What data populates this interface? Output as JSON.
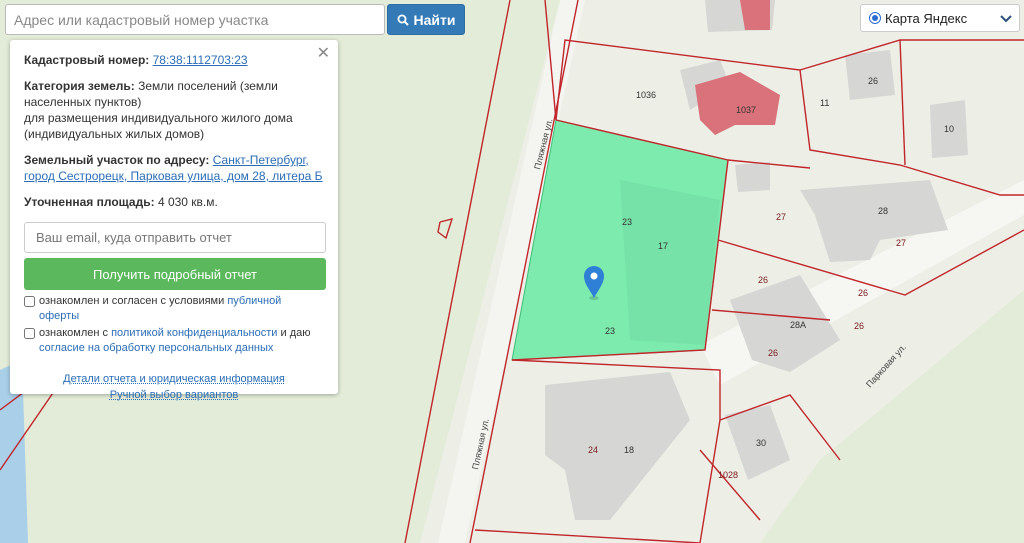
{
  "search": {
    "placeholder": "Адрес или кадастровый номер участка",
    "button_label": "Найти"
  },
  "layer": {
    "selected": "Карта Яндекс"
  },
  "panel": {
    "cadastral_label": "Кадастровый номер:",
    "cadastral_value": "78:38:1112703:23",
    "category_label": "Категория земель:",
    "category_value": "Земли поселений (земли населенных пунктов)",
    "purpose": "для размещения индивидуального жилого дома (индивидуальных жилых домов)",
    "address_label": "Земельный участок по адресу:",
    "address_value": "Санкт-Петербург, город Сестрорецк, Парковая улица, дом 28, литера Б",
    "area_label": "Уточненная площадь:",
    "area_value": "4 030 кв.м.",
    "email_placeholder": "Ваш email, куда отправить отчет",
    "report_button": "Получить подробный отчет",
    "check1_text": "ознакомлен и согласен с условиями ",
    "check1_link": "публичной оферты",
    "check2_text_a": "ознакомлен с ",
    "check2_link_a": "политикой конфиденциальности",
    "check2_text_b": " и даю",
    "check2_link_b": "согласие на обработку персональных данных",
    "details_link": "Детали отчета и юридическая информация",
    "manual_link": "Ручной выбор вариантов"
  },
  "map": {
    "streets": {
      "plyazhnaya": "Пляжная ул.",
      "parkovaya": "Парковая ул."
    },
    "parcel_labels": [
      "1036",
      "1037",
      "11",
      "26",
      "10",
      "23",
      "17",
      "23",
      "27",
      "28",
      "27",
      "26",
      "26",
      "28А",
      "26",
      "26",
      "24",
      "18",
      "30",
      "1028"
    ],
    "highlight_color": "#7deaae",
    "boundary_color": "#c0262b"
  }
}
